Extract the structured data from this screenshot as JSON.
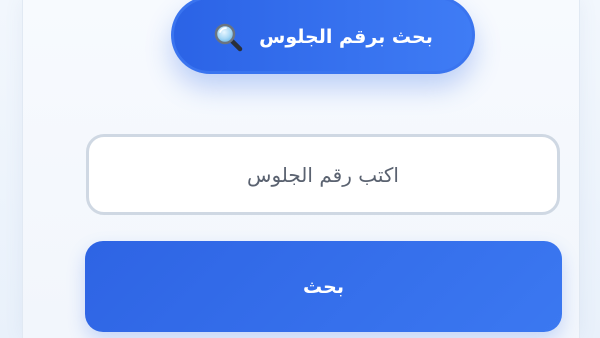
{
  "header": {
    "title": "بحث برقم الجلوس",
    "icon": "magnifier-icon"
  },
  "search": {
    "placeholder": "اكتب رقم الجلوس",
    "value": ""
  },
  "button": {
    "label": "بحث"
  },
  "colors": {
    "accent": "#2f6be8",
    "background": "#f2f7fd",
    "input_border": "#cfd8e3"
  }
}
